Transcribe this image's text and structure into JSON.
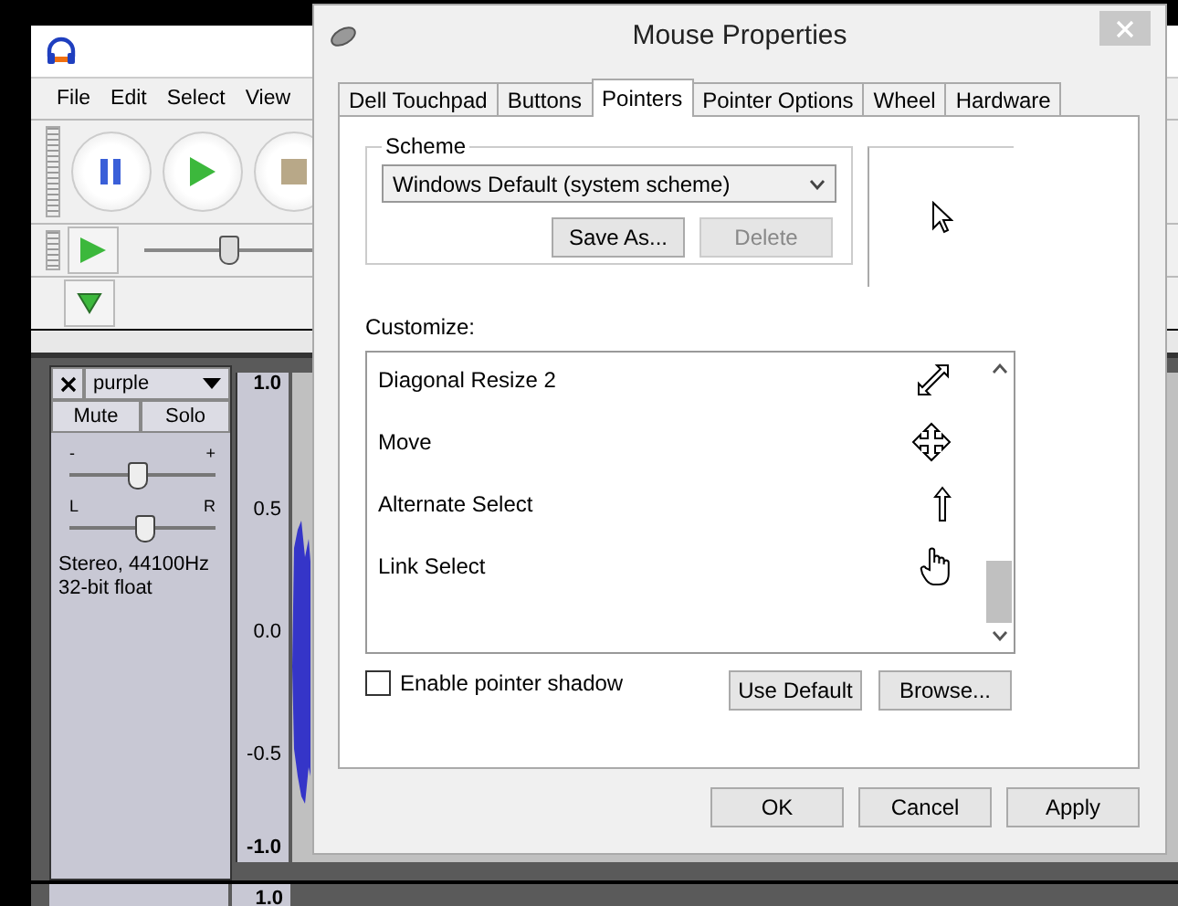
{
  "audacity": {
    "menu": [
      "File",
      "Edit",
      "Select",
      "View"
    ],
    "speed": {
      "level": 0.45
    },
    "track": {
      "name": "purple",
      "buttons": [
        "Mute",
        "Solo"
      ],
      "gain": {
        "minus": "-",
        "plus": "+",
        "level": 0.45
      },
      "pan": {
        "left": "L",
        "right": "R",
        "level": 0.5
      },
      "info": [
        "Stereo, 44100Hz",
        "32-bit float"
      ]
    },
    "ruler": [
      "1.0",
      "0.5",
      "0.0",
      "-0.5",
      "-1.0"
    ],
    "next_track_ruler": "1.0"
  },
  "dialog": {
    "title": "Mouse Properties",
    "tabs": [
      {
        "label": "Dell Touchpad",
        "selected": false
      },
      {
        "label": "Buttons",
        "selected": false
      },
      {
        "label": "Pointers",
        "selected": true
      },
      {
        "label": "Pointer Options",
        "selected": false
      },
      {
        "label": "Wheel",
        "selected": false
      },
      {
        "label": "Hardware",
        "selected": false
      }
    ],
    "scheme": {
      "label": "Scheme",
      "value": "Windows Default (system scheme)",
      "buttons": [
        {
          "label": "Save As...",
          "disabled": false
        },
        {
          "label": "Delete",
          "disabled": true
        }
      ]
    },
    "customize": {
      "label": "Customize:",
      "items": [
        {
          "name": "Diagonal Resize 2",
          "kind": "diagonal"
        },
        {
          "name": "Move",
          "kind": "move"
        },
        {
          "name": "Alternate Select",
          "kind": "up"
        },
        {
          "name": "Link Select",
          "kind": "hand"
        }
      ]
    },
    "shadow": {
      "label": "Enable pointer shadow",
      "checked": false
    },
    "list_buttons": [
      "Use Default",
      "Browse..."
    ],
    "buttons": [
      "OK",
      "Cancel",
      "Apply"
    ]
  }
}
